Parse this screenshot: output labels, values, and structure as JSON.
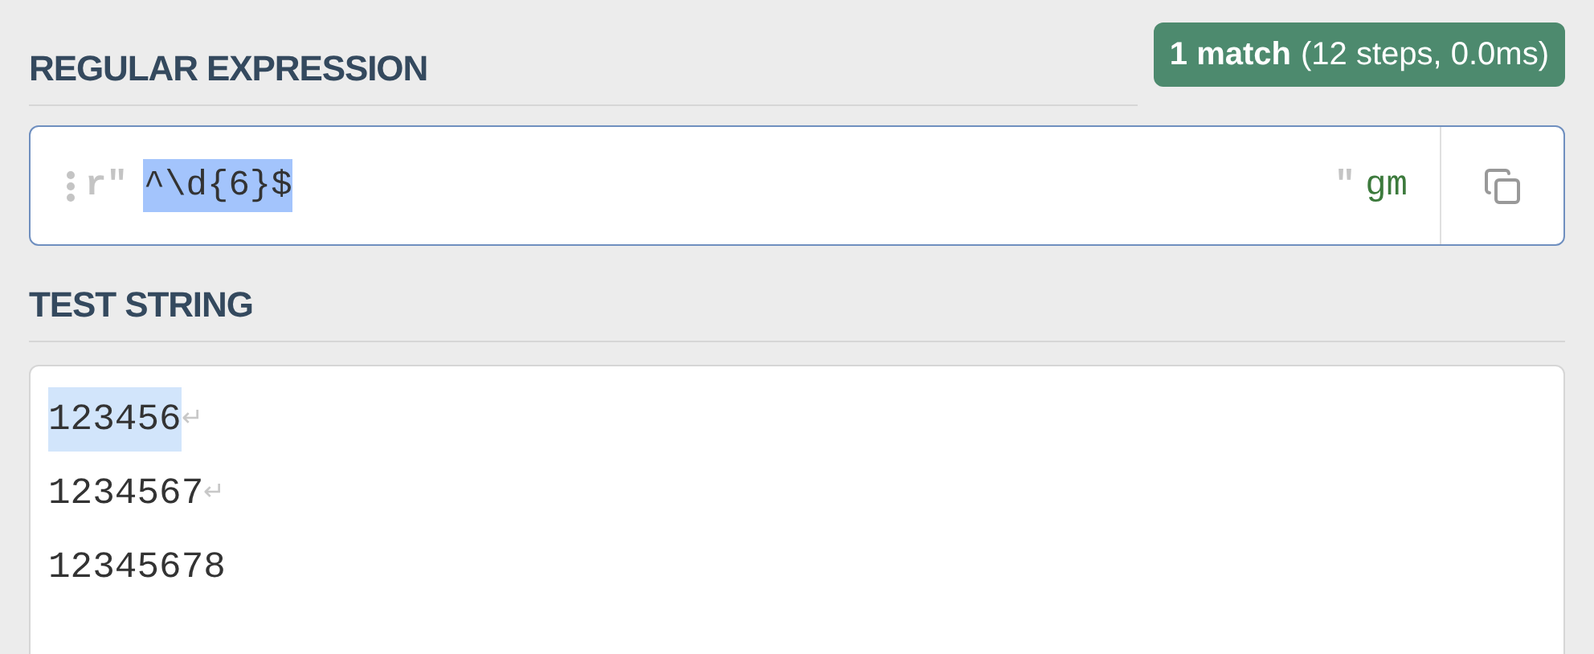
{
  "regex_section": {
    "title": "REGULAR EXPRESSION",
    "match_badge": {
      "count": "1 match",
      "details": "(12 steps, 0.0ms)"
    },
    "editor": {
      "open_delimiter": "r\"",
      "pattern": "^\\d{6}$",
      "pattern_selected": true,
      "close_delimiter": "\"",
      "flags": "gm"
    }
  },
  "test_section": {
    "title": "TEST STRING",
    "lines": [
      {
        "text": "123456",
        "matched": true,
        "end_mark": "↵"
      },
      {
        "text": "1234567",
        "matched": false,
        "end_mark": "↵"
      },
      {
        "text": "12345678",
        "matched": false
      }
    ]
  }
}
